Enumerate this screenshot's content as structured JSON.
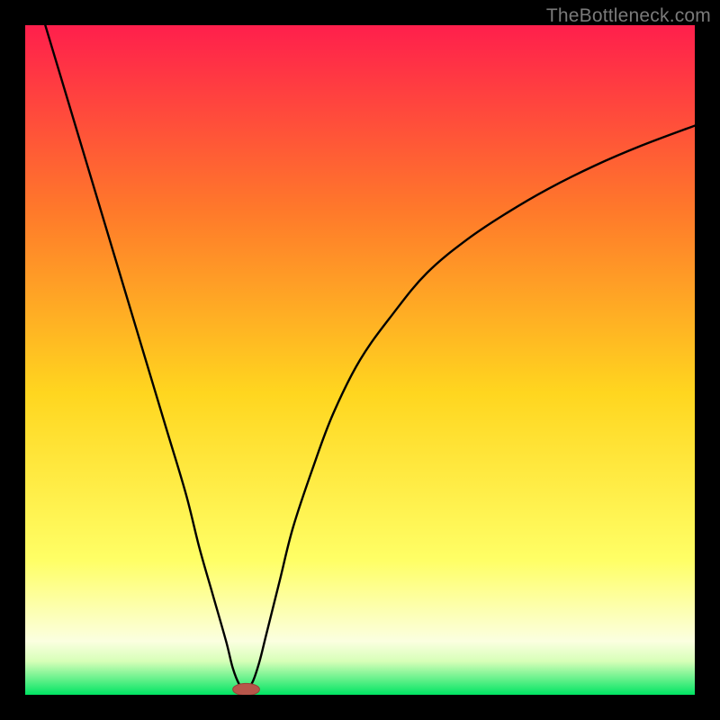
{
  "watermark": "TheBottleneck.com",
  "colors": {
    "bg": "#000000",
    "gradient_top": "#ff1f4c",
    "gradient_mid_upper": "#ff7a2a",
    "gradient_mid": "#ffd61f",
    "gradient_lower": "#ffff66",
    "gradient_pale": "#fbffe0",
    "gradient_green": "#00e463",
    "curve": "#000000",
    "marker_fill": "#b7564a",
    "marker_stroke": "#9a4038"
  },
  "chart_data": {
    "type": "line",
    "title": "",
    "xlabel": "",
    "ylabel": "",
    "xlim": [
      0,
      100
    ],
    "ylim": [
      0,
      100
    ],
    "notch_x": 33,
    "marker": {
      "x": 33,
      "y": 0.8,
      "rx": 2.0,
      "ry": 0.9
    },
    "series": [
      {
        "name": "left-branch",
        "x": [
          3,
          6,
          9,
          12,
          15,
          18,
          21,
          24,
          26,
          28,
          30,
          31,
          32,
          33
        ],
        "y": [
          100,
          90,
          80,
          70,
          60,
          50,
          40,
          30,
          22,
          15,
          8,
          4,
          1.5,
          0.5
        ]
      },
      {
        "name": "right-branch",
        "x": [
          33,
          34,
          35,
          36,
          38,
          40,
          43,
          46,
          50,
          55,
          60,
          66,
          72,
          78,
          85,
          92,
          100
        ],
        "y": [
          0.5,
          2,
          5,
          9,
          17,
          25,
          34,
          42,
          50,
          57,
          63,
          68,
          72,
          75.5,
          79,
          82,
          85
        ]
      }
    ],
    "gradient_stops": [
      {
        "pct": 0,
        "color": "#ff1f4c"
      },
      {
        "pct": 28,
        "color": "#ff7a2a"
      },
      {
        "pct": 55,
        "color": "#ffd61f"
      },
      {
        "pct": 80,
        "color": "#ffff66"
      },
      {
        "pct": 92,
        "color": "#fbffe0"
      },
      {
        "pct": 95,
        "color": "#d7ffb8"
      },
      {
        "pct": 100,
        "color": "#00e463"
      }
    ]
  }
}
